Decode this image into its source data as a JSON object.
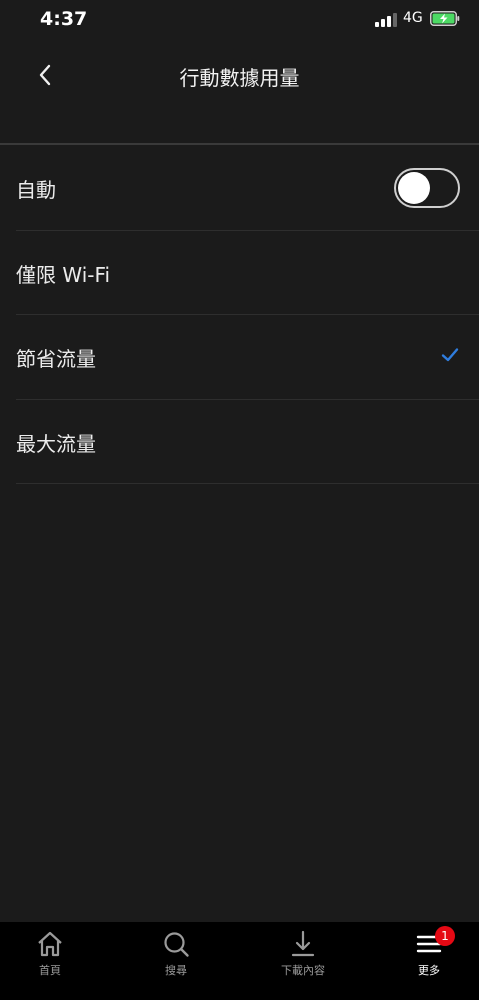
{
  "status_bar": {
    "time": "4:37",
    "network": "4G"
  },
  "header": {
    "title": "行動數據用量",
    "back_icon": "chevron-left-icon"
  },
  "options": [
    {
      "label": "自動",
      "control": "toggle",
      "toggle_on": false
    },
    {
      "label": "僅限 Wi-Fi"
    },
    {
      "label": "節省流量",
      "selected": true
    },
    {
      "label": "最大流量"
    }
  ],
  "tab_bar": {
    "items": [
      {
        "label": "首頁",
        "icon": "home-icon"
      },
      {
        "label": "搜尋",
        "icon": "search-icon"
      },
      {
        "label": "下載內容",
        "icon": "download-icon"
      },
      {
        "label": "更多",
        "icon": "menu-icon",
        "badge": "1",
        "active": true
      }
    ]
  },
  "colors": {
    "background": "#1b1b1b",
    "check_accent": "#2f7dde",
    "badge_red": "#e50914",
    "battery_green": "#4cd964"
  }
}
